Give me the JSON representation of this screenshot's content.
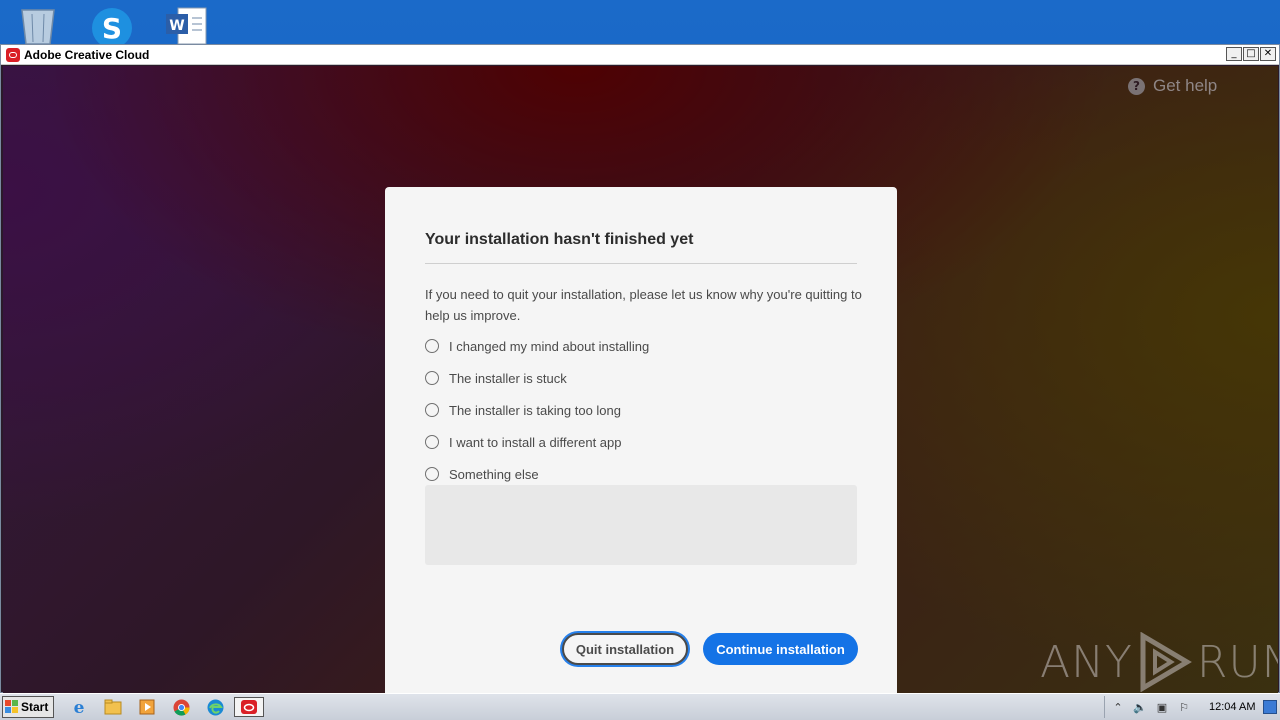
{
  "window": {
    "title": "Adobe Creative Cloud",
    "controls": {
      "minimize": "_",
      "maximize": "□",
      "close": "✕"
    }
  },
  "header": {
    "get_help": "Get help",
    "help_icon": "question-circle-icon"
  },
  "dialog": {
    "title": "Your installation hasn't finished yet",
    "message": "If you need to quit your installation, please let us know why you're quitting to help us improve.",
    "options": [
      {
        "label": "I changed my mind about installing",
        "selected": false
      },
      {
        "label": "The installer is stuck",
        "selected": false
      },
      {
        "label": "The installer is taking too long",
        "selected": false
      },
      {
        "label": "I want to install a different app",
        "selected": false
      },
      {
        "label": "Something else",
        "selected": false
      }
    ],
    "comment_value": "",
    "quit_button": "Quit installation",
    "continue_button": "Continue installation"
  },
  "watermark": {
    "text_left": "ANY",
    "text_right": "RUN"
  },
  "taskbar": {
    "start": "Start",
    "clock": "12:04 AM",
    "apps": [
      "internet-explorer-icon",
      "file-explorer-icon",
      "media-player-icon",
      "chrome-icon",
      "edge-icon",
      "creative-cloud-icon"
    ]
  },
  "desktop": {
    "icons": [
      "recycle-bin-icon",
      "skype-icon",
      "word-icon"
    ]
  },
  "colors": {
    "accent": "#1473e6",
    "dialog_bg": "#f5f5f5",
    "adobe_red": "#da1f26"
  }
}
